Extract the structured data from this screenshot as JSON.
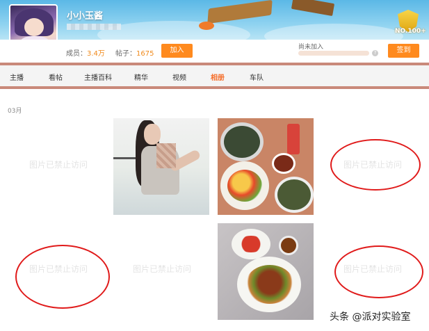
{
  "header": {
    "group_name": "小小玉酱",
    "badge": "NO.100+"
  },
  "stats": {
    "members_label": "成员：",
    "members_value": "3.4万",
    "posts_label": "帖子：",
    "posts_value": "1675",
    "join_button": "加入",
    "join_status": "尚未加入",
    "join_progress": 0.0,
    "help_icon": "?",
    "signin_button": "签到"
  },
  "nav": {
    "items": [
      {
        "label": "主播"
      },
      {
        "label": "看帖"
      },
      {
        "label": "主播百科"
      },
      {
        "label": "精华"
      },
      {
        "label": "视频"
      },
      {
        "label": "相册",
        "active": true
      },
      {
        "label": "车队"
      }
    ]
  },
  "album": {
    "month": "03月",
    "blocked_text": "图片已禁止访问",
    "annotation_color": "#e01a1a"
  },
  "footer": {
    "watermark": "头条 @派对实验室"
  },
  "colors": {
    "accent": "#ff8a1e",
    "active_tab": "#f56e2a",
    "nav_border": "#c9897a"
  }
}
